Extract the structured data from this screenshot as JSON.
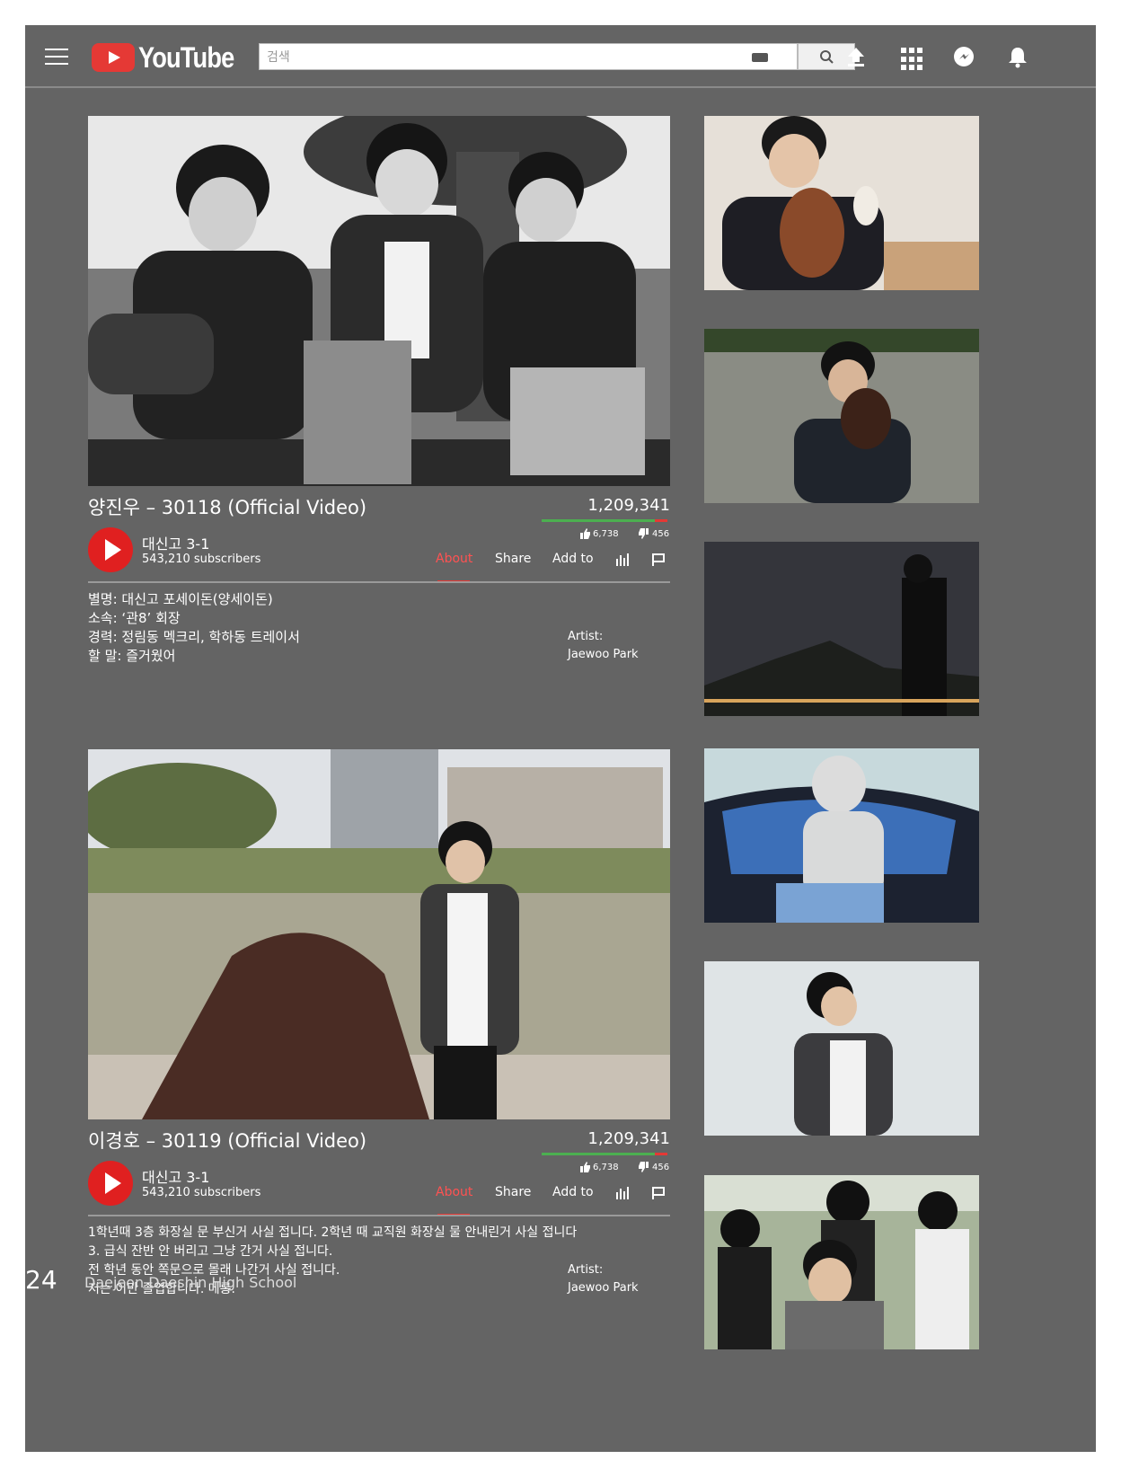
{
  "header": {
    "logo_text": "YouTube",
    "search_placeholder": "검색"
  },
  "videos": [
    {
      "title": "양진우 – 30118 (Official Video)",
      "views": "1,209,341",
      "likes": "6,738",
      "dislikes": "456",
      "channel": "대신고 3-1",
      "subscribers": "543,210 subscribers",
      "tabs": [
        "About",
        "Share",
        "Add to"
      ],
      "description": [
        "별명: 대신고 포세이돈(양세이돈)",
        "소속: ‘관8’ 회장",
        "경력: 정림동 멕크리, 학하동 트레이서",
        "할 말: 즐거웠어"
      ],
      "artist_label": "Artist:",
      "artist_name": "Jaewoo Park"
    },
    {
      "title": "이경호 – 30119 (Official Video)",
      "views": "1,209,341",
      "likes": "6,738",
      "dislikes": "456",
      "channel": "대신고 3-1",
      "subscribers": "543,210 subscribers",
      "tabs": [
        "About",
        "Share",
        "Add to"
      ],
      "description": [
        "1학년때 3층 화장실 문 부신거 사실 접니다. 2학년 때 교직원 화장실 물 안내린거 사실 접니다",
        "3. 급식 잔반 안 버리고 그냥 간거 사실 접니다.",
        "전 학년 동안 쪽문으로 몰래 나간거 사실 접니다.",
        "저는 이만 졸업합니다. 메롱."
      ],
      "artist_label": "Artist:",
      "artist_name": "Jaewoo Park"
    }
  ],
  "footer": {
    "page_number": "24",
    "school": "Daejeon Daeshin High School"
  },
  "colors": {
    "background": "#646464",
    "accent": "#e53935",
    "like_bar": "#4caf50"
  }
}
